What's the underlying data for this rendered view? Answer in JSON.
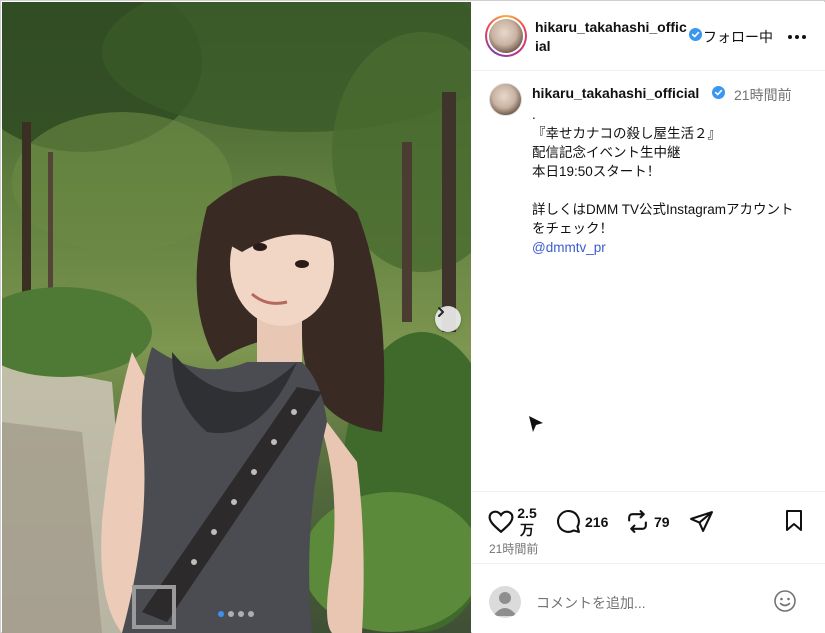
{
  "header": {
    "username": "hikaru_takahashi_official",
    "follow_label": "フォロー中",
    "more_icon": "more-horizontal-icon"
  },
  "post": {
    "username": "hikaru_takahashi_official",
    "time": "21時間前",
    "caption_lines": [
      ".",
      "『幸せカナコの殺し屋生活２』",
      "配信記念イベント生中継",
      "本日19:50スタート！",
      "",
      "詳しくはDMM TV公式Instagramアカウント",
      "をチェック！"
    ],
    "mention": "@dmmtv_pr"
  },
  "actions": {
    "likes": "2.5",
    "likes_unit": "万",
    "comments": "216",
    "reposts": "79",
    "timestamp": "21時間前"
  },
  "comment_box": {
    "placeholder": "コメントを追加..."
  },
  "carousel": {
    "total": 4,
    "current": 1
  },
  "colors": {
    "verified": "#3897f0",
    "mention": "#3b5bcf",
    "active_dot": "#3b91f0"
  }
}
